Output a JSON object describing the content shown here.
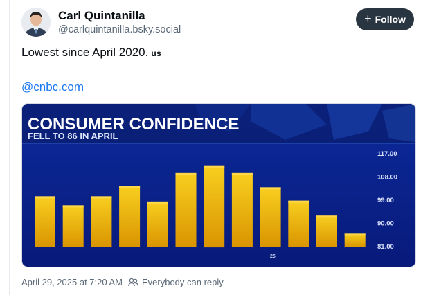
{
  "author": {
    "display_name": "Carl Quintanilla",
    "handle": "@carlquintanilla.bsky.social",
    "avatar_icon": "person-avatar-icon"
  },
  "follow_button": {
    "icon": "plus-icon",
    "label": "Follow"
  },
  "post": {
    "text": "Lowest since April 2020.",
    "flag": "us",
    "link_text": "@cnbc.com"
  },
  "media": {
    "headline": "CONSUMER CONFIDENCE",
    "subheadline": "FELL TO 86 IN APRIL",
    "y_ticks": [
      "117.00",
      "108.00",
      "99.00",
      "90.00",
      "81.00"
    ],
    "x_label": "25",
    "bar_values": [
      100.5,
      97,
      100.5,
      104.5,
      98.5,
      109.5,
      112.5,
      109.5,
      104,
      98.8,
      93,
      86
    ],
    "colors": {
      "background": "#0a1f8a",
      "bar_top": "#f6c40a",
      "bar_bottom": "#e19e00"
    }
  },
  "footer": {
    "timestamp": "April 29, 2025 at 7:20 AM",
    "audience_icon": "people-icon",
    "audience": "Everybody can reply"
  }
}
